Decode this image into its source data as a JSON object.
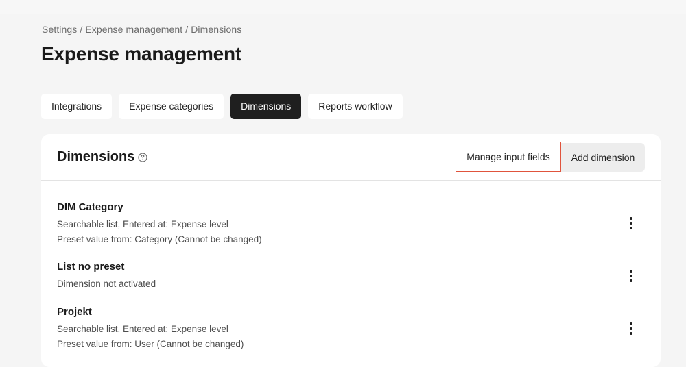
{
  "breadcrumb": "Settings / Expense management / Dimensions",
  "page_title": "Expense management",
  "tabs": [
    {
      "label": "Integrations",
      "active": false
    },
    {
      "label": "Expense categories",
      "active": false
    },
    {
      "label": "Dimensions",
      "active": true
    },
    {
      "label": "Reports workflow",
      "active": false
    }
  ],
  "card": {
    "title": "Dimensions",
    "help_icon": "question-circle-icon",
    "manage_label": "Manage input fields",
    "add_label": "Add dimension"
  },
  "dimensions": [
    {
      "name": "DIM Category",
      "line1": "Searchable list, Entered at: Expense level",
      "line2": "Preset value from: Category (Cannot be changed)"
    },
    {
      "name": "List no preset",
      "line1": "Dimension not activated"
    },
    {
      "name": "Projekt",
      "line1": "Searchable list, Entered at: Expense level",
      "line2": "Preset value from: User (Cannot be changed)"
    }
  ],
  "colors": {
    "accent_outline": "#e0533c",
    "active_tab": "#1f1f1f",
    "background": "#f5f5f5"
  }
}
